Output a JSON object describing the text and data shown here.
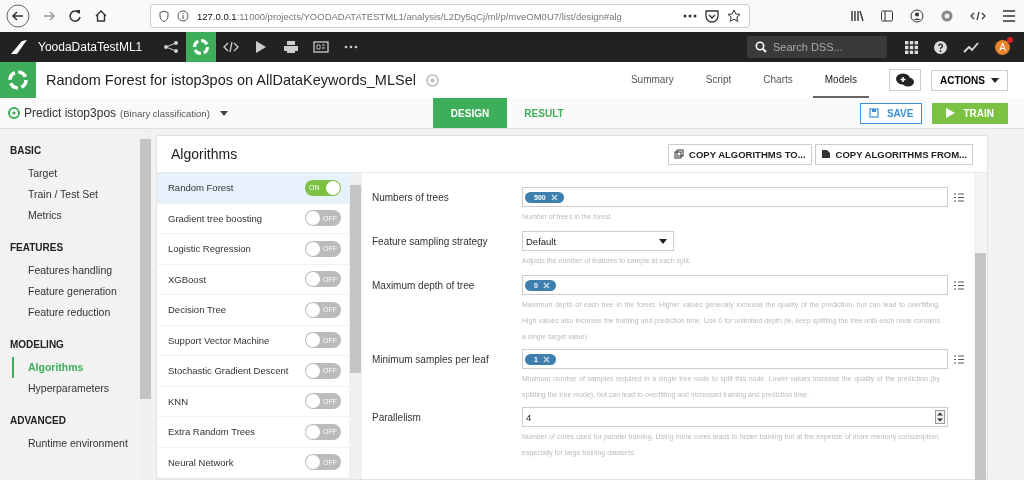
{
  "browser": {
    "url_host": "127.0.0.1",
    "url_rest": ":11000/projects/YOODADATATESTML1/analysis/L2Dy5qCj/ml/p/mveOM0U7/list/design#alg"
  },
  "nav": {
    "project": "YoodaDataTestML1",
    "search": {
      "placeholder": "Search DSS..."
    },
    "avatar": "A",
    "notification": true
  },
  "header": {
    "title": "Random Forest for istop3pos on AllDataKeywords_MLSel",
    "tabs": [
      {
        "label": "Summary",
        "selected": false
      },
      {
        "label": "Script",
        "selected": false
      },
      {
        "label": "Charts",
        "selected": false
      },
      {
        "label": "Models",
        "selected": true
      }
    ],
    "actions": "ACTIONS"
  },
  "subbar": {
    "task": "Predict istop3pos",
    "task_type": "(Binary classification)",
    "tabs": [
      {
        "label": "DESIGN",
        "selected": true
      },
      {
        "label": "RESULT",
        "selected": false
      }
    ],
    "save": "SAVE",
    "train": "TRAIN"
  },
  "sidebar": {
    "sections": [
      {
        "title": "BASIC",
        "items": [
          {
            "label": "Target",
            "selected": false
          },
          {
            "label": "Train / Test Set",
            "selected": false
          },
          {
            "label": "Metrics",
            "selected": false
          }
        ]
      },
      {
        "title": "FEATURES",
        "items": [
          {
            "label": "Features handling",
            "selected": false
          },
          {
            "label": "Feature generation",
            "selected": false
          },
          {
            "label": "Feature reduction",
            "selected": false
          }
        ]
      },
      {
        "title": "MODELING",
        "items": [
          {
            "label": "Algorithms",
            "selected": true
          },
          {
            "label": "Hyperparameters",
            "selected": false
          }
        ]
      },
      {
        "title": "ADVANCED",
        "items": [
          {
            "label": "Runtime environment",
            "selected": false
          }
        ]
      }
    ]
  },
  "panel": {
    "title": "Algorithms",
    "buttons": [
      "COPY ALGORITHMS TO...",
      "COPY ALGORITHMS FROM..."
    ],
    "algorithms": [
      {
        "name": "Random Forest",
        "selected": true,
        "on": true,
        "toggle": "ON"
      },
      {
        "name": "Gradient tree boosting",
        "selected": false,
        "on": false,
        "toggle": "OFF"
      },
      {
        "name": "Logistic Regression",
        "selected": false,
        "on": false,
        "toggle": "OFF"
      },
      {
        "name": "XGBoost",
        "selected": false,
        "on": false,
        "toggle": "OFF"
      },
      {
        "name": "Decision Tree",
        "selected": false,
        "on": false,
        "toggle": "OFF"
      },
      {
        "name": "Support Vector Machine",
        "selected": false,
        "on": false,
        "toggle": "OFF"
      },
      {
        "name": "Stochastic Gradient Descent",
        "selected": false,
        "on": false,
        "toggle": "OFF"
      },
      {
        "name": "KNN",
        "selected": false,
        "on": false,
        "toggle": "OFF"
      },
      {
        "name": "Extra Random Trees",
        "selected": false,
        "on": false,
        "toggle": "OFF"
      },
      {
        "name": "Neural Network",
        "selected": false,
        "on": false,
        "toggle": "OFF"
      }
    ],
    "params": [
      {
        "kind": "tags",
        "label": "Numbers of trees",
        "tags": [
          "500"
        ],
        "help": "Number of trees in the forest."
      },
      {
        "kind": "select",
        "label": "Feature sampling strategy",
        "value": "Default",
        "help": "Adjusts the number of features to sample at each split."
      },
      {
        "kind": "tags",
        "label": "Maximum depth of tree",
        "tags": [
          "0"
        ],
        "help": "Maximum depth of each tree in the forest. Higher values generally increase the quality of the prediction, but can lead to overfitting. High values also increase the training and prediction time. Use 0 for unlimited depth (ie, keep splitting the tree until each node contains a single target value)"
      },
      {
        "kind": "tags",
        "label": "Minimum samples per leaf",
        "tags": [
          "1"
        ],
        "help": "Minimum number of samples required in a single tree node to split this node. Lower values increase the quality of the prediction (by splitting the tree mode), but can lead to overfitting and increased training and prediction time."
      },
      {
        "kind": "number",
        "label": "Parallelism",
        "value": "4",
        "help": "Number of cores used for parallel training. Using more cores leads to faster training but at the expense of more memory consumption, especially for large training datasets."
      }
    ]
  }
}
